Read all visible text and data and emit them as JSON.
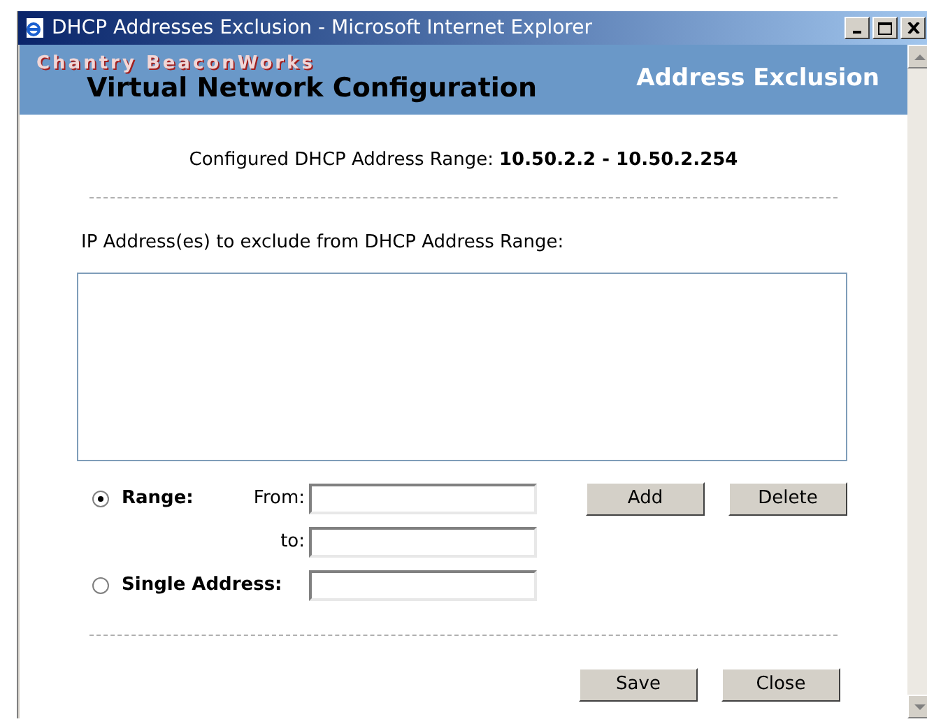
{
  "window": {
    "title": "DHCP Addresses Exclusion - Microsoft Internet Explorer"
  },
  "header": {
    "brand": "Chantry BeaconWorks",
    "product": "Virtual Network Configuration",
    "page_title": "Address Exclusion"
  },
  "range_info": {
    "label": "Configured DHCP Address Range:",
    "value": "10.50.2.2 - 10.50.2.254"
  },
  "exclusion_list": {
    "label": "IP Address(es) to exclude from DHCP Address Range:"
  },
  "options": [
    {
      "label": "Range:",
      "selected": true
    },
    {
      "label": "Single Address:",
      "selected": false
    }
  ],
  "range_fields": [
    {
      "label": "From:"
    },
    {
      "label": "to:"
    }
  ],
  "list_buttons": [
    "Add",
    "Delete"
  ],
  "footer_buttons": [
    "Save",
    "Close"
  ]
}
